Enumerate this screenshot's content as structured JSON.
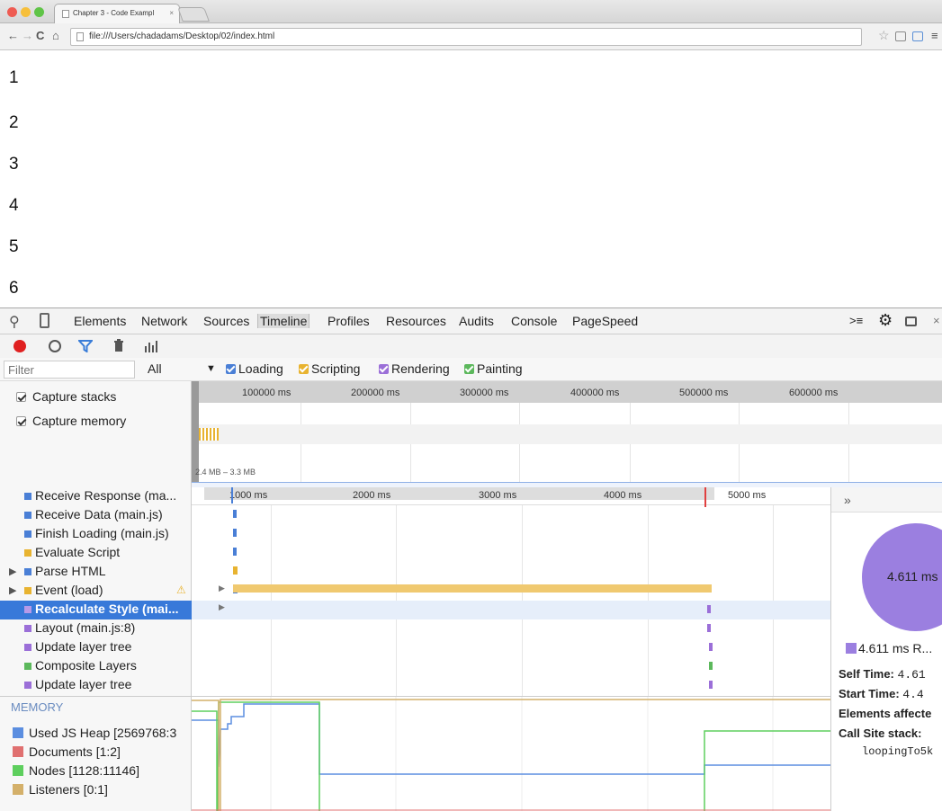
{
  "browser": {
    "tab_title": "Chapter 3 - Code Exampl",
    "tab_close": "×",
    "url": "file:///Users/chadadams/Desktop/02/index.html"
  },
  "page": {
    "numbers": [
      "1",
      "2",
      "3",
      "4",
      "5",
      "6"
    ]
  },
  "devtools": {
    "tabs": [
      "Elements",
      "Network",
      "Sources",
      "Timeline",
      "Profiles",
      "Resources",
      "Audits",
      "Console",
      "PageSpeed"
    ],
    "active_tab": "Timeline",
    "filter_placeholder": "Filter",
    "filter_all": "All",
    "categories": [
      {
        "label": "Loading",
        "color": "#4a7fd6"
      },
      {
        "label": "Scripting",
        "color": "#e8b330"
      },
      {
        "label": "Rendering",
        "color": "#9b6fd8"
      },
      {
        "label": "Painting",
        "color": "#5cb85c"
      }
    ],
    "capture_stacks": "Capture stacks",
    "capture_memory": "Capture memory",
    "overview_ticks": [
      "100000 ms",
      "200000 ms",
      "300000 ms",
      "400000 ms",
      "500000 ms",
      "600000 ms"
    ],
    "memory_range": "2.4 MB – 3.3 MB",
    "detail_ticks": [
      "1000 ms",
      "2000 ms",
      "3000 ms",
      "4000 ms",
      "5000 ms"
    ],
    "records": [
      {
        "label": "Receive Response (ma...",
        "color": "#4a7fd6"
      },
      {
        "label": "Receive Data (main.js)",
        "color": "#4a7fd6"
      },
      {
        "label": "Finish Loading (main.js)",
        "color": "#4a7fd6"
      },
      {
        "label": "Evaluate Script",
        "color": "#e8b330"
      },
      {
        "label": "Parse HTML",
        "color": "#4a7fd6",
        "expandable": true
      },
      {
        "label": "Event (load)",
        "color": "#e8b330",
        "expandable": true,
        "warning": true
      },
      {
        "label": "Recalculate Style (mai...",
        "color": "#9b6fd8",
        "selected": true
      },
      {
        "label": "Layout (main.js:8)",
        "color": "#9b6fd8"
      },
      {
        "label": "Update layer tree",
        "color": "#9b6fd8"
      },
      {
        "label": "Composite Layers",
        "color": "#5cb85c"
      },
      {
        "label": "Update layer tree",
        "color": "#9b6fd8"
      }
    ],
    "details": {
      "expand": "»",
      "pie_value": "4.611 ms",
      "legend": "4.611 ms R...",
      "self_time_label": "Self Time:",
      "self_time_value": "4.61",
      "start_time_label": "Start Time:",
      "start_time_value": "4.4",
      "elements_label": "Elements affecte",
      "call_site_label": "Call Site stack:",
      "call_site_fn": "loopingTo5k"
    },
    "memory": {
      "title": "MEMORY",
      "items": [
        {
          "label": "Used JS Heap [2569768:3",
          "color": "#5b8ee0"
        },
        {
          "label": "Documents [1:2]",
          "color": "#e07070"
        },
        {
          "label": "Nodes [1128:11146]",
          "color": "#5ecf5e"
        },
        {
          "label": "Listeners [0:1]",
          "color": "#d4b06a"
        }
      ]
    }
  }
}
